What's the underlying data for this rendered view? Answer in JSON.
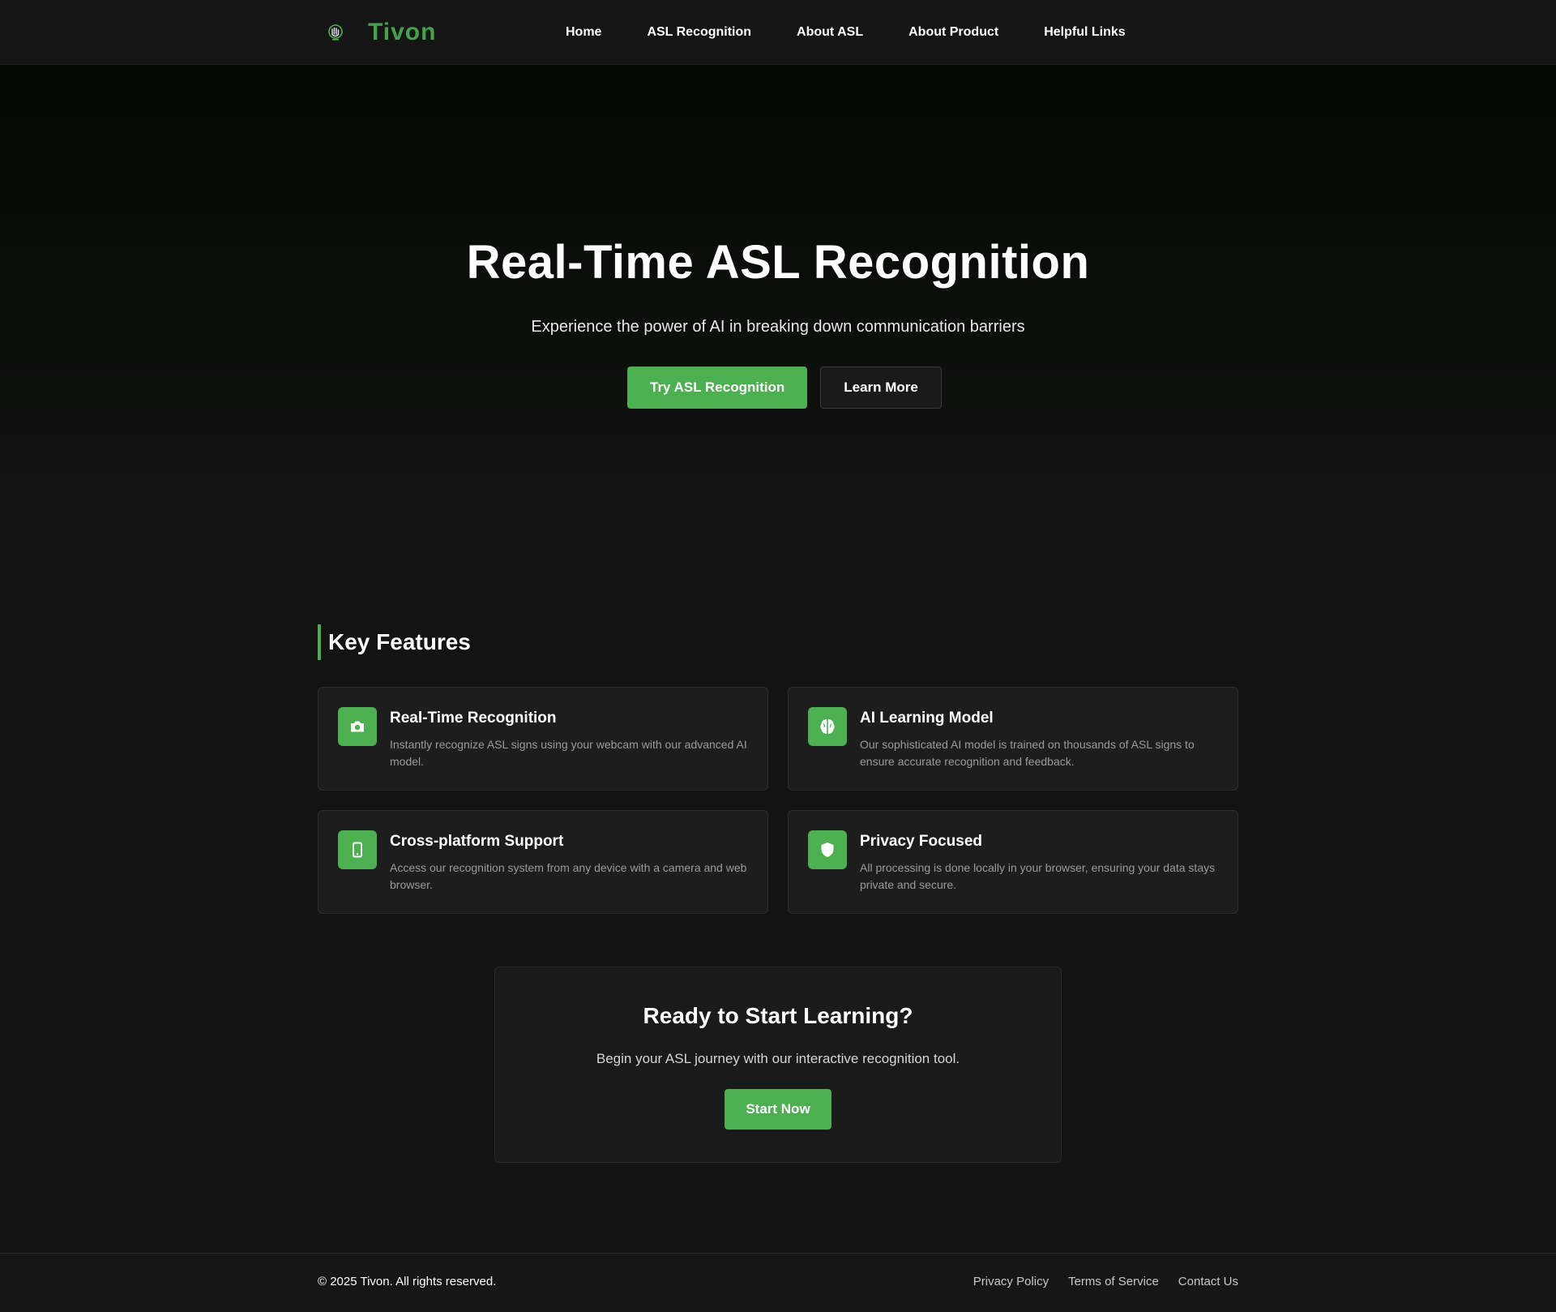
{
  "colors": {
    "accent": "#4caf50",
    "brand_text": "#43a34a",
    "background": "#131313",
    "card_background": "#1d1d1d"
  },
  "nav": {
    "brand_icon": "hand-logo-icon",
    "brand_name": "Tivon",
    "links": [
      {
        "label": "Home"
      },
      {
        "label": "ASL Recognition"
      },
      {
        "label": "About ASL"
      },
      {
        "label": "About Product"
      },
      {
        "label": "Helpful Links"
      }
    ]
  },
  "hero": {
    "title": "Real-Time ASL Recognition",
    "subtitle": "Experience the power of AI in breaking down communication barriers",
    "primary_button": "Try ASL Recognition",
    "secondary_button": "Learn More"
  },
  "features": {
    "heading": "Key Features",
    "items": [
      {
        "icon": "camera-icon",
        "title": "Real-Time Recognition",
        "description": "Instantly recognize ASL signs using your webcam with our advanced AI model."
      },
      {
        "icon": "brain-icon",
        "title": "AI Learning Model",
        "description": "Our sophisticated AI model is trained on thousands of ASL signs to ensure accurate recognition and feedback."
      },
      {
        "icon": "mobile-icon",
        "title": "Cross-platform Support",
        "description": "Access our recognition system from any device with a camera and web browser."
      },
      {
        "icon": "shield-icon",
        "title": "Privacy Focused",
        "description": "All processing is done locally in your browser, ensuring your data stays private and secure."
      }
    ]
  },
  "cta": {
    "title": "Ready to Start Learning?",
    "text": "Begin your ASL journey with our interactive recognition tool.",
    "button": "Start Now"
  },
  "footer": {
    "copyright": "© 2025 Tivon. All rights reserved.",
    "links": [
      {
        "label": "Privacy Policy"
      },
      {
        "label": "Terms of Service"
      },
      {
        "label": "Contact Us"
      }
    ]
  }
}
